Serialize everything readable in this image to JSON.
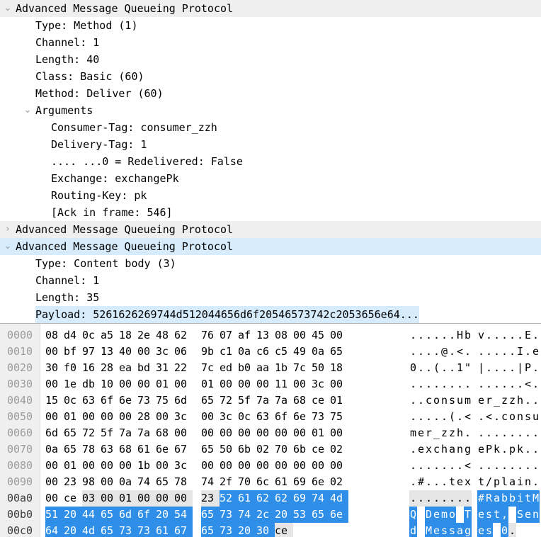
{
  "detail_tree": [
    {
      "indent": 0,
      "twisty": "expanded",
      "text": "Advanced Message Queueing Protocol",
      "bg": "gray",
      "link": false
    },
    {
      "indent": 1,
      "twisty": "none",
      "text": "Type: Method (1)",
      "bg": "none",
      "link": false
    },
    {
      "indent": 1,
      "twisty": "none",
      "text": "Channel: 1",
      "bg": "none",
      "link": false
    },
    {
      "indent": 1,
      "twisty": "none",
      "text": "Length: 40",
      "bg": "none",
      "link": false
    },
    {
      "indent": 1,
      "twisty": "none",
      "text": "Class: Basic (60)",
      "bg": "none",
      "link": false
    },
    {
      "indent": 1,
      "twisty": "none",
      "text": "Method: Deliver (60)",
      "bg": "none",
      "link": false
    },
    {
      "indent": 1,
      "twisty": "expanded",
      "text": "Arguments",
      "bg": "none",
      "link": false
    },
    {
      "indent": 2,
      "twisty": "none",
      "text": "Consumer-Tag: consumer_zzh",
      "bg": "none",
      "link": false
    },
    {
      "indent": 2,
      "twisty": "none",
      "text": "Delivery-Tag: 1",
      "bg": "none",
      "link": false
    },
    {
      "indent": 2,
      "twisty": "none",
      "text": ".... ...0 = Redelivered: False",
      "bg": "none",
      "link": false
    },
    {
      "indent": 2,
      "twisty": "none",
      "text": "Exchange: exchangePk",
      "bg": "none",
      "link": false
    },
    {
      "indent": 2,
      "twisty": "none",
      "text": "Routing-Key: pk",
      "bg": "none",
      "link": false
    },
    {
      "indent": 2,
      "twisty": "none",
      "text": "[Ack in frame: 546]",
      "bg": "none",
      "link": true
    },
    {
      "indent": 0,
      "twisty": "collapsed",
      "text": "Advanced Message Queueing Protocol",
      "bg": "gray",
      "link": false
    },
    {
      "indent": 0,
      "twisty": "expanded",
      "text": "Advanced Message Queueing Protocol",
      "bg": "blue",
      "link": false
    },
    {
      "indent": 1,
      "twisty": "none",
      "text": "Type: Content body (3)",
      "bg": "none",
      "link": false
    },
    {
      "indent": 1,
      "twisty": "none",
      "text": "Channel: 1",
      "bg": "none",
      "link": false
    },
    {
      "indent": 1,
      "twisty": "none",
      "text": "Length: 35",
      "bg": "none",
      "link": false
    },
    {
      "indent": 1,
      "twisty": "none",
      "text": "Payload: 5261626269744d512044656d6f20546573742c2053656e64...",
      "bg": "none",
      "link": false,
      "highlight_text": true
    }
  ],
  "twisty_glyphs": {
    "expanded": "⌄",
    "collapsed": "›",
    "none": ""
  },
  "hex_dump": {
    "rows": [
      {
        "offset": "0000",
        "offset_active": false,
        "bytes": [
          "08",
          "d4",
          "0c",
          "a5",
          "18",
          "2e",
          "48",
          "62",
          "76",
          "07",
          "af",
          "13",
          "08",
          "00",
          "45",
          "00"
        ],
        "ascii": [
          ".",
          ".",
          ".",
          ".",
          ".",
          ".",
          "H",
          "b",
          "v",
          ".",
          ".",
          ".",
          ".",
          ".",
          "E",
          "."
        ],
        "sel": []
      },
      {
        "offset": "0010",
        "offset_active": false,
        "bytes": [
          "00",
          "bf",
          "97",
          "13",
          "40",
          "00",
          "3c",
          "06",
          "9b",
          "c1",
          "0a",
          "c6",
          "c5",
          "49",
          "0a",
          "65"
        ],
        "ascii": [
          ".",
          ".",
          ".",
          ".",
          "@",
          ".",
          "<",
          ".",
          ".",
          ".",
          ".",
          ".",
          ".",
          "I",
          ".",
          "e"
        ],
        "sel": []
      },
      {
        "offset": "0020",
        "offset_active": false,
        "bytes": [
          "30",
          "f0",
          "16",
          "28",
          "ea",
          "bd",
          "31",
          "22",
          "7c",
          "ed",
          "b0",
          "aa",
          "1b",
          "7c",
          "50",
          "18"
        ],
        "ascii": [
          "0",
          ".",
          ".",
          "(",
          ".",
          ".",
          "1",
          "\"",
          "|",
          ".",
          ".",
          ".",
          ".",
          "|",
          "P",
          "."
        ],
        "sel": []
      },
      {
        "offset": "0030",
        "offset_active": false,
        "bytes": [
          "00",
          "1e",
          "db",
          "10",
          "00",
          "00",
          "01",
          "00",
          "01",
          "00",
          "00",
          "00",
          "11",
          "00",
          "3c",
          "00"
        ],
        "ascii": [
          ".",
          ".",
          ".",
          ".",
          ".",
          ".",
          ".",
          ".",
          ".",
          ".",
          ".",
          ".",
          ".",
          ".",
          "<",
          "."
        ],
        "sel": []
      },
      {
        "offset": "0040",
        "offset_active": false,
        "bytes": [
          "15",
          "0c",
          "63",
          "6f",
          "6e",
          "73",
          "75",
          "6d",
          "65",
          "72",
          "5f",
          "7a",
          "7a",
          "68",
          "ce",
          "01"
        ],
        "ascii": [
          ".",
          ".",
          "c",
          "o",
          "n",
          "s",
          "u",
          "m",
          "e",
          "r",
          "_",
          "z",
          "z",
          "h",
          ".",
          "."
        ],
        "sel": []
      },
      {
        "offset": "0050",
        "offset_active": false,
        "bytes": [
          "00",
          "01",
          "00",
          "00",
          "00",
          "28",
          "00",
          "3c",
          "00",
          "3c",
          "0c",
          "63",
          "6f",
          "6e",
          "73",
          "75"
        ],
        "ascii": [
          ".",
          ".",
          ".",
          ".",
          ".",
          "(",
          ".",
          "<",
          ".",
          "<",
          ".",
          "c",
          "o",
          "n",
          "s",
          "u"
        ],
        "sel": []
      },
      {
        "offset": "0060",
        "offset_active": false,
        "bytes": [
          "6d",
          "65",
          "72",
          "5f",
          "7a",
          "7a",
          "68",
          "00",
          "00",
          "00",
          "00",
          "00",
          "00",
          "00",
          "01",
          "00"
        ],
        "ascii": [
          "m",
          "e",
          "r",
          "_",
          "z",
          "z",
          "h",
          ".",
          ".",
          ".",
          ".",
          ".",
          ".",
          ".",
          ".",
          "."
        ],
        "sel": []
      },
      {
        "offset": "0070",
        "offset_active": false,
        "bytes": [
          "0a",
          "65",
          "78",
          "63",
          "68",
          "61",
          "6e",
          "67",
          "65",
          "50",
          "6b",
          "02",
          "70",
          "6b",
          "ce",
          "02"
        ],
        "ascii": [
          ".",
          "e",
          "x",
          "c",
          "h",
          "a",
          "n",
          "g",
          "e",
          "P",
          "k",
          ".",
          "p",
          "k",
          ".",
          "."
        ],
        "sel": []
      },
      {
        "offset": "0080",
        "offset_active": false,
        "bytes": [
          "00",
          "01",
          "00",
          "00",
          "00",
          "1b",
          "00",
          "3c",
          "00",
          "00",
          "00",
          "00",
          "00",
          "00",
          "00",
          "00"
        ],
        "ascii": [
          ".",
          ".",
          ".",
          ".",
          ".",
          ".",
          ".",
          "<",
          ".",
          ".",
          ".",
          ".",
          ".",
          ".",
          ".",
          "."
        ],
        "sel": []
      },
      {
        "offset": "0090",
        "offset_active": false,
        "bytes": [
          "00",
          "23",
          "98",
          "00",
          "0a",
          "74",
          "65",
          "78",
          "74",
          "2f",
          "70",
          "6c",
          "61",
          "69",
          "6e",
          "02"
        ],
        "ascii": [
          ".",
          "#",
          ".",
          ".",
          ".",
          "t",
          "e",
          "x",
          "t",
          "/",
          "p",
          "l",
          "a",
          "i",
          "n",
          "."
        ],
        "sel": []
      },
      {
        "offset": "00a0",
        "offset_active": true,
        "bytes": [
          "00",
          "ce",
          "03",
          "00",
          "01",
          "00",
          "00",
          "00",
          "23",
          "52",
          "61",
          "62",
          "62",
          "69",
          "74",
          "4d"
        ],
        "ascii": [
          ".",
          ".",
          ".",
          ".",
          ".",
          ".",
          ".",
          ".",
          "#",
          "R",
          "a",
          "b",
          "b",
          "i",
          "t",
          "M"
        ],
        "sel": [
          "none",
          "none",
          "gray",
          "gray",
          "gray",
          "gray",
          "gray",
          "gray",
          "gray",
          "blue",
          "blue",
          "blue",
          "blue",
          "blue",
          "blue",
          "blue"
        ],
        "ascii_sel": [
          "gray",
          "gray",
          "gray",
          "gray",
          "gray",
          "gray",
          "gray",
          "gray",
          "blue",
          "blue",
          "blue",
          "blue",
          "blue",
          "blue",
          "blue",
          "blue"
        ]
      },
      {
        "offset": "00b0",
        "offset_active": true,
        "bytes": [
          "51",
          "20",
          "44",
          "65",
          "6d",
          "6f",
          "20",
          "54",
          "65",
          "73",
          "74",
          "2c",
          "20",
          "53",
          "65",
          "6e"
        ],
        "ascii": [
          "Q",
          " ",
          "D",
          "e",
          "m",
          "o",
          " ",
          "T",
          "e",
          "s",
          "t",
          ",",
          " ",
          "S",
          "e",
          "n"
        ],
        "sel": [
          "blue",
          "blue",
          "blue",
          "blue",
          "blue",
          "blue",
          "blue",
          "blue",
          "blue",
          "blue",
          "blue",
          "blue",
          "blue",
          "blue",
          "blue",
          "blue"
        ],
        "ascii_sel": [
          "blue",
          "blue",
          "blue",
          "blue",
          "blue",
          "blue",
          "blue",
          "blue",
          "blue",
          "blue",
          "blue",
          "blue",
          "blue",
          "blue",
          "blue",
          "blue"
        ]
      },
      {
        "offset": "00c0",
        "offset_active": true,
        "bytes": [
          "64",
          "20",
          "4d",
          "65",
          "73",
          "73",
          "61",
          "67",
          "65",
          "73",
          "20",
          "30",
          "ce"
        ],
        "ascii": [
          "d",
          " ",
          "M",
          "e",
          "s",
          "s",
          "a",
          "g",
          "e",
          "s",
          " ",
          "0",
          "."
        ],
        "sel": [
          "blue",
          "blue",
          "blue",
          "blue",
          "blue",
          "blue",
          "blue",
          "blue",
          "blue",
          "blue",
          "blue",
          "blue",
          "gray"
        ],
        "ascii_sel": [
          "blue",
          "blue",
          "blue",
          "blue",
          "blue",
          "blue",
          "blue",
          "blue",
          "blue",
          "blue",
          "blue",
          "blue",
          "gray"
        ]
      }
    ]
  },
  "colors": {
    "row_gray": "#efefef",
    "row_blue": "#d6ebfb",
    "selection_blue": "#2f8fe8",
    "selection_gray": "#e6e6e6",
    "link_blue": "#1a24d0",
    "offset_gray": "#9b9b9b"
  }
}
